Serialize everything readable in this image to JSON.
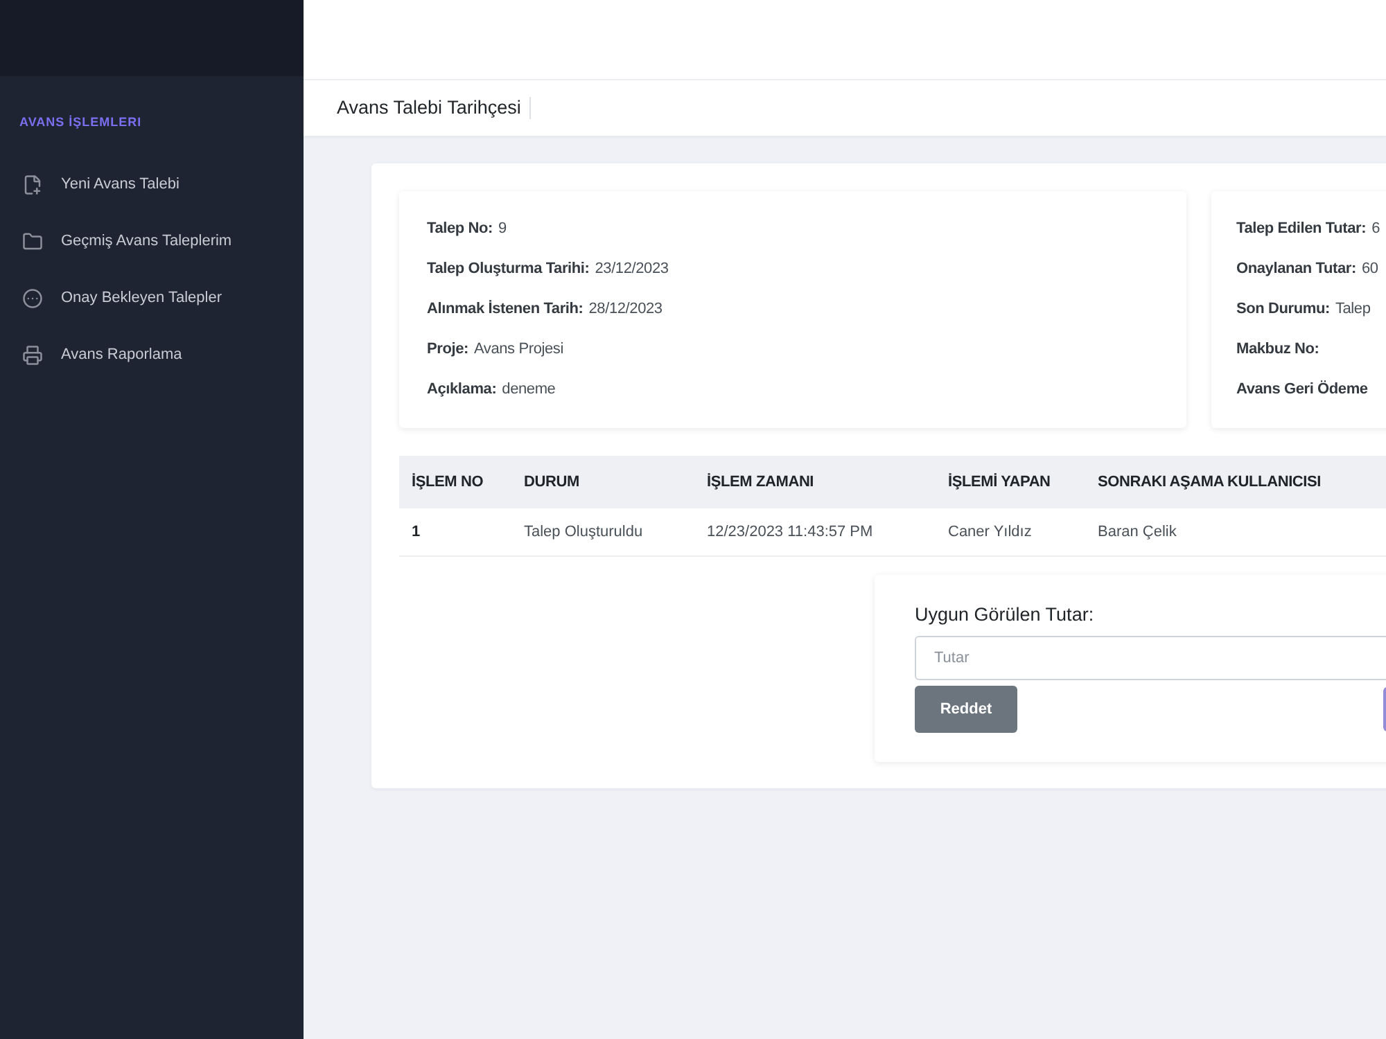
{
  "sidebar": {
    "section_title": "AVANS İŞLEMLERI",
    "items": [
      {
        "label": "Yeni Avans Talebi"
      },
      {
        "label": "Geçmiş Avans Taleplerim"
      },
      {
        "label": "Onay Bekleyen Talepler"
      },
      {
        "label": "Avans Raporlama"
      }
    ]
  },
  "breadcrumb": {
    "title": "Avans Talebi Tarihçesi"
  },
  "details": {
    "left": [
      {
        "label": "Talep No:",
        "value": "9"
      },
      {
        "label": "Talep Oluşturma Tarihi:",
        "value": "23/12/2023"
      },
      {
        "label": "Alınmak İstenen Tarih:",
        "value": "28/12/2023"
      },
      {
        "label": "Proje:",
        "value": "Avans Projesi"
      },
      {
        "label": "Açıklama:",
        "value": "deneme"
      }
    ],
    "right": [
      {
        "label": "Talep Edilen Tutar:",
        "value": "6"
      },
      {
        "label": "Onaylanan Tutar:",
        "value": "60"
      },
      {
        "label": "Son Durumu:",
        "value": "Talep"
      },
      {
        "label": "Makbuz No:"
      },
      {
        "label": "Avans Geri Ödeme"
      }
    ]
  },
  "history_table": {
    "columns": [
      "İŞLEM NO",
      "DURUM",
      "İŞLEM ZAMANI",
      "İŞLEMİ YAPAN",
      "SONRAKI AŞAMA KULLANICISI"
    ],
    "rows": [
      {
        "cells": [
          "1",
          "Talep Oluşturuldu",
          "12/23/2023 11:43:57 PM",
          "Caner Yıldız",
          "Baran Çelik"
        ]
      }
    ]
  },
  "approval_form": {
    "label": "Uygun Görülen Tutar:",
    "amount_field": {
      "placeholder": "Tutar"
    },
    "buttons": [
      {
        "label": "Reddet"
      }
    ]
  }
}
